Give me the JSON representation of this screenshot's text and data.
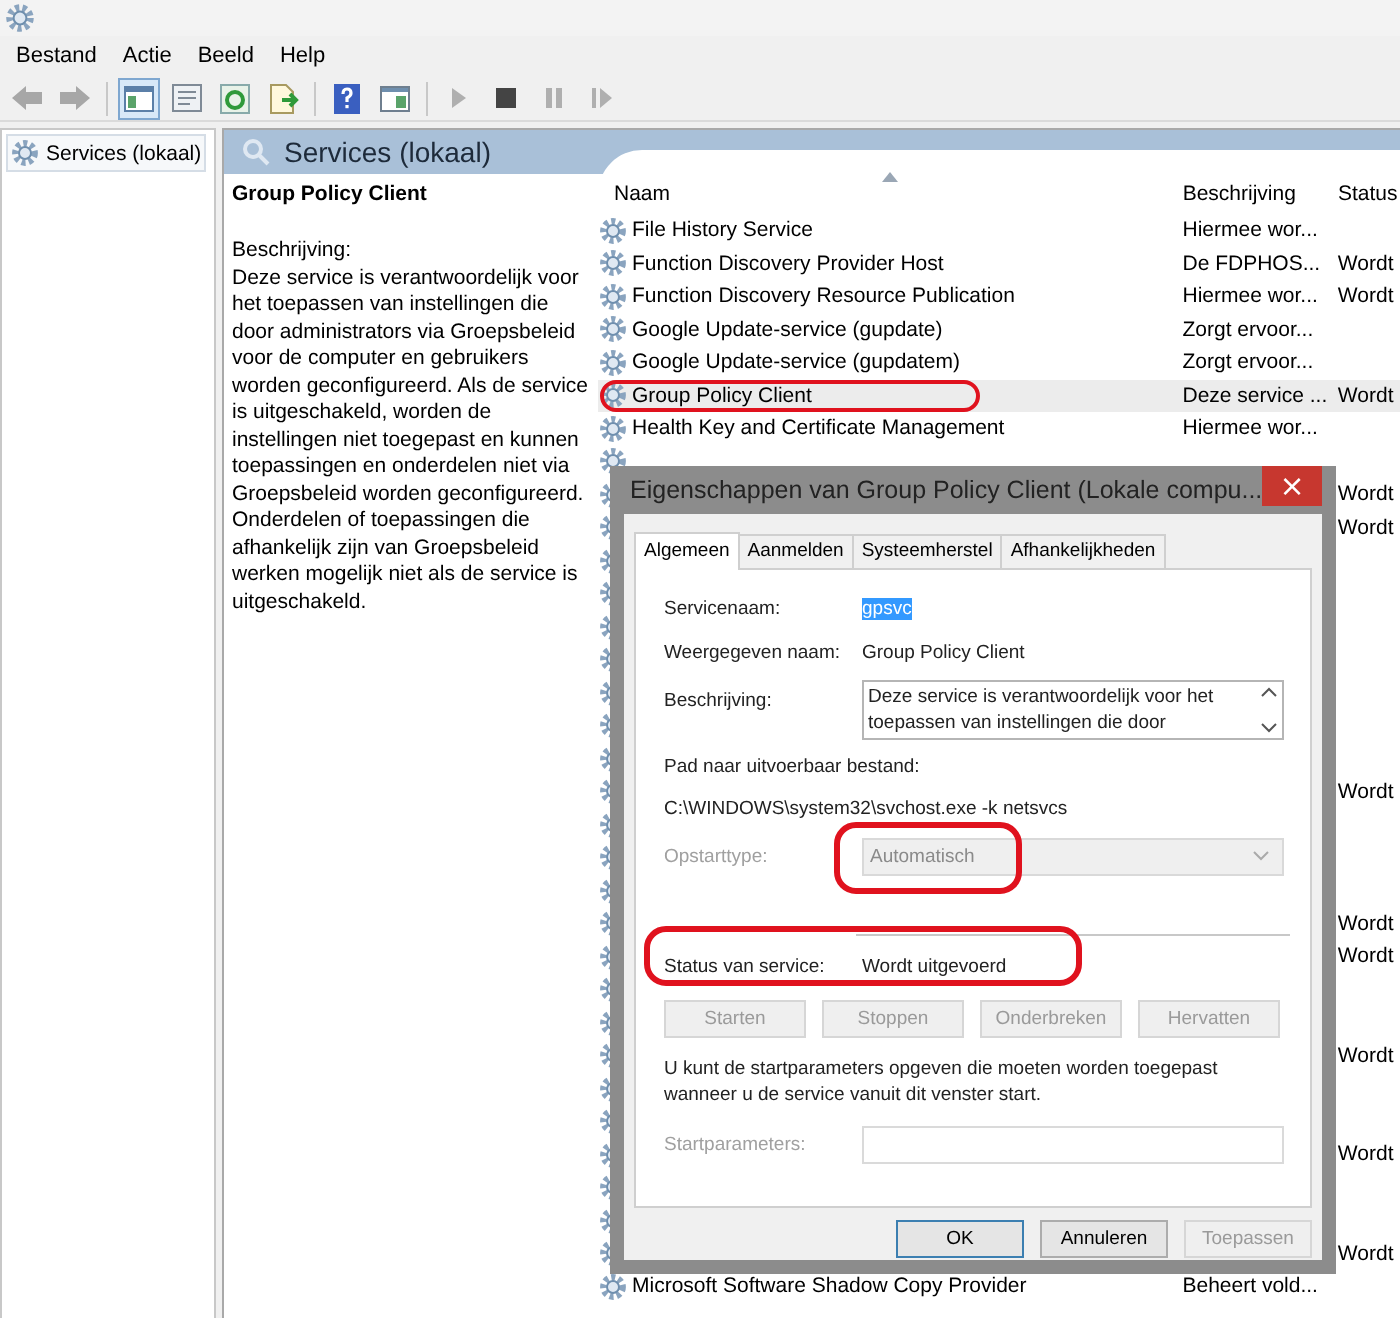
{
  "menu": [
    "Bestand",
    "Actie",
    "Beeld",
    "Help"
  ],
  "toolbar": [
    {
      "kind": "back",
      "disabled": true,
      "pressed": false
    },
    {
      "kind": "forward",
      "disabled": true,
      "pressed": false
    },
    {
      "kind": "sep"
    },
    {
      "kind": "tree",
      "disabled": false,
      "pressed": true
    },
    {
      "kind": "properties",
      "disabled": false,
      "pressed": false
    },
    {
      "kind": "refresh",
      "disabled": false,
      "pressed": false
    },
    {
      "kind": "export",
      "disabled": false,
      "pressed": false
    },
    {
      "kind": "sep"
    },
    {
      "kind": "help",
      "disabled": false,
      "pressed": false
    },
    {
      "kind": "console",
      "disabled": false,
      "pressed": false
    },
    {
      "kind": "sep"
    },
    {
      "kind": "play",
      "disabled": true,
      "pressed": false
    },
    {
      "kind": "stop",
      "disabled": false,
      "pressed": false
    },
    {
      "kind": "pause",
      "disabled": true,
      "pressed": false
    },
    {
      "kind": "resume",
      "disabled": true,
      "pressed": false
    }
  ],
  "tree": {
    "items": [
      {
        "label": "Services (lokaal)",
        "selected": true
      }
    ]
  },
  "pane": {
    "title": "Services (lokaal)"
  },
  "detail": {
    "title": "Group Policy Client",
    "label": "Beschrijving:",
    "text": "Deze service is verantwoordelijk voor het toepassen van instellingen die door administrators via Groepsbeleid voor de computer en gebruikers worden geconfigureerd. Als de service is uitgeschakeld, worden de instellingen niet toegepast en kunnen toepassingen en onderdelen niet via Groepsbeleid worden geconfigureerd. Onderdelen of toepassingen die afhankelijk zijn van Groepsbeleid werken mogelijk niet als de service is uitgeschakeld."
  },
  "table": {
    "columns": [
      {
        "label": "Naam",
        "sorted": true
      },
      {
        "label": "Beschrijving",
        "sorted": false
      },
      {
        "label": "Status",
        "sorted": false
      }
    ],
    "rows": [
      {
        "name": "File History Service",
        "description": "Hiermee wor...",
        "selected": false,
        "highlighted": false
      },
      {
        "name": "Function Discovery Provider Host",
        "description": "De FDPHOS...",
        "status": "Wordt",
        "selected": false,
        "highlighted": false
      },
      {
        "name": "Function Discovery Resource Publication",
        "description": "Hiermee wor...",
        "status": "Wordt",
        "selected": false,
        "highlighted": false
      },
      {
        "name": "Google Update-service (gupdate)",
        "description": "Zorgt ervoor...",
        "selected": false,
        "highlighted": false
      },
      {
        "name": "Google Update-service (gupdatem)",
        "description": "Zorgt ervoor...",
        "selected": false,
        "highlighted": false
      },
      {
        "name": "Group Policy Client",
        "description": "Deze service ...",
        "status": "Wordt",
        "selected": true,
        "highlighted": true
      },
      {
        "name": "Health Key and Certificate Management",
        "description": "Hiermee wor...",
        "selected": false,
        "highlighted": false
      },
      {
        "selected": false,
        "highlighted": false
      },
      {
        "status": "Wordt",
        "selected": false,
        "highlighted": false
      },
      {
        "status": "Wordt",
        "selected": false,
        "highlighted": false
      },
      {
        "selected": false,
        "highlighted": false
      },
      {
        "selected": false,
        "highlighted": false
      },
      {
        "selected": false,
        "highlighted": false
      },
      {
        "selected": false,
        "highlighted": false
      },
      {
        "selected": false,
        "highlighted": false
      },
      {
        "selected": false,
        "highlighted": false
      },
      {
        "selected": false,
        "highlighted": false
      },
      {
        "status": "Wordt",
        "selected": false,
        "highlighted": false
      },
      {
        "selected": false,
        "highlighted": false
      },
      {
        "selected": false,
        "highlighted": false
      },
      {
        "selected": false,
        "highlighted": false
      },
      {
        "status": "Wordt",
        "selected": false,
        "highlighted": false
      },
      {
        "status": "Wordt",
        "selected": false,
        "highlighted": false
      },
      {
        "selected": false,
        "highlighted": false
      },
      {
        "selected": false,
        "highlighted": false
      },
      {
        "status": "Wordt",
        "selected": false,
        "highlighted": false
      },
      {
        "selected": false,
        "highlighted": false
      },
      {
        "selected": false,
        "highlighted": false
      },
      {
        "status": "Wordt",
        "selected": false,
        "highlighted": false
      },
      {
        "selected": false,
        "highlighted": false
      },
      {
        "selected": false,
        "highlighted": false
      },
      {
        "status": "Wordt",
        "selected": false,
        "highlighted": false
      },
      {
        "name": "Microsoft Software Shadow Copy Provider",
        "description": "Beheert vold...",
        "selected": false,
        "highlighted": false
      }
    ]
  },
  "dialog": {
    "title": "Eigenschappen van Group Policy Client (Lokale compu...",
    "close": "×",
    "tabs": [
      {
        "label": "Algemeen",
        "selected": true
      },
      {
        "label": "Aanmelden",
        "selected": false
      },
      {
        "label": "Systeemherstel",
        "selected": false
      },
      {
        "label": "Afhankelijkheden",
        "selected": false
      }
    ],
    "service_name": {
      "label": "Servicenaam:",
      "value": "gpsvc",
      "selected": true
    },
    "display_name": {
      "label": "Weergegeven naam:",
      "value": "Group Policy Client"
    },
    "description": {
      "label": "Beschrijving:",
      "value": "Deze service is verantwoordelijk voor het toepassen van instellingen die door"
    },
    "path": {
      "label": "Pad naar uitvoerbaar bestand:",
      "value": "C:\\WINDOWS\\system32\\svchost.exe -k netsvcs"
    },
    "startup_type": {
      "label": "Opstarttype:",
      "value": "Automatisch",
      "disabled": true,
      "highlighted": true
    },
    "service_status": {
      "label": "Status van service:",
      "value": "Wordt uitgevoerd",
      "highlighted": true
    },
    "control_buttons": [
      {
        "label": "Starten",
        "disabled": true
      },
      {
        "label": "Stoppen",
        "disabled": true
      },
      {
        "label": "Onderbreken",
        "disabled": true
      },
      {
        "label": "Hervatten",
        "disabled": true
      }
    ],
    "hint": "U kunt de startparameters opgeven die moeten worden toegepast wanneer u de service vanuit dit venster start.",
    "start_parameters": {
      "label": "Startparameters:",
      "disabled": true
    },
    "buttons": [
      {
        "label": "OK",
        "default": true,
        "disabled": false
      },
      {
        "label": "Annuleren",
        "default": false,
        "disabled": false
      },
      {
        "label": "Toepassen",
        "default": false,
        "disabled": true
      }
    ]
  }
}
